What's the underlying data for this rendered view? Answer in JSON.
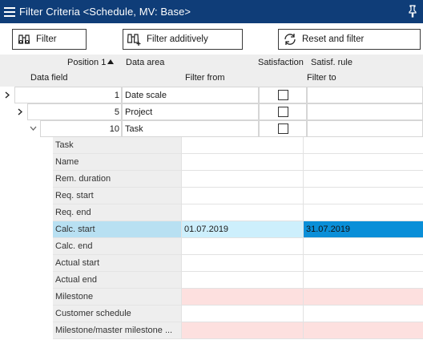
{
  "window": {
    "title": "Filter Criteria <Schedule, MV: Base>"
  },
  "toolbar": {
    "filter_label": "Filter",
    "filter_additively_label": "Filter additively",
    "reset_filter_label": "Reset and filter"
  },
  "header": {
    "position": "Position",
    "sort_indicator": "1",
    "data_area": "Data area",
    "satisfaction": "Satisfaction",
    "satisf_rule": "Satisf. rule",
    "data_field": "Data field",
    "filter_from": "Filter from",
    "filter_to": "Filter to"
  },
  "areas": [
    {
      "position": "1",
      "name": "Date scale",
      "expander": "collapsed"
    },
    {
      "position": "5",
      "name": "Project",
      "expander": "collapsed"
    },
    {
      "position": "10",
      "name": "Task",
      "expander": "expanded"
    }
  ],
  "fields": [
    {
      "label": "Task",
      "from": "",
      "to": ""
    },
    {
      "label": "Name",
      "from": "",
      "to": ""
    },
    {
      "label": "Rem. duration",
      "from": "",
      "to": ""
    },
    {
      "label": "Req. start",
      "from": "",
      "to": ""
    },
    {
      "label": "Req. end",
      "from": "",
      "to": ""
    },
    {
      "label": "Calc. start",
      "from": "01.07.2019",
      "to": "31.07.2019",
      "selected": true
    },
    {
      "label": "Calc. end",
      "from": "",
      "to": ""
    },
    {
      "label": "Actual start",
      "from": "",
      "to": ""
    },
    {
      "label": "Actual end",
      "from": "",
      "to": ""
    },
    {
      "label": "Milestone",
      "from": "",
      "to": "",
      "highlight": true
    },
    {
      "label": "Customer schedule",
      "from": "",
      "to": ""
    },
    {
      "label": "Milestone/master milestone ...",
      "from": "",
      "to": "",
      "highlight": true
    }
  ],
  "colors": {
    "titlebar": "#0f3d78",
    "selection_accent": "#0a8fd8",
    "selection_light": "#cdeffc",
    "highlight_pink": "#fde0df",
    "header_gray": "#eeeeee"
  },
  "icons": {
    "menu": "hamburger-icon",
    "pin": "pin-icon",
    "filter": "binoculars-icon",
    "filter_additively": "binoculars-plus-icon",
    "reset": "refresh-icon",
    "checkbox": "checkbox-unchecked"
  }
}
